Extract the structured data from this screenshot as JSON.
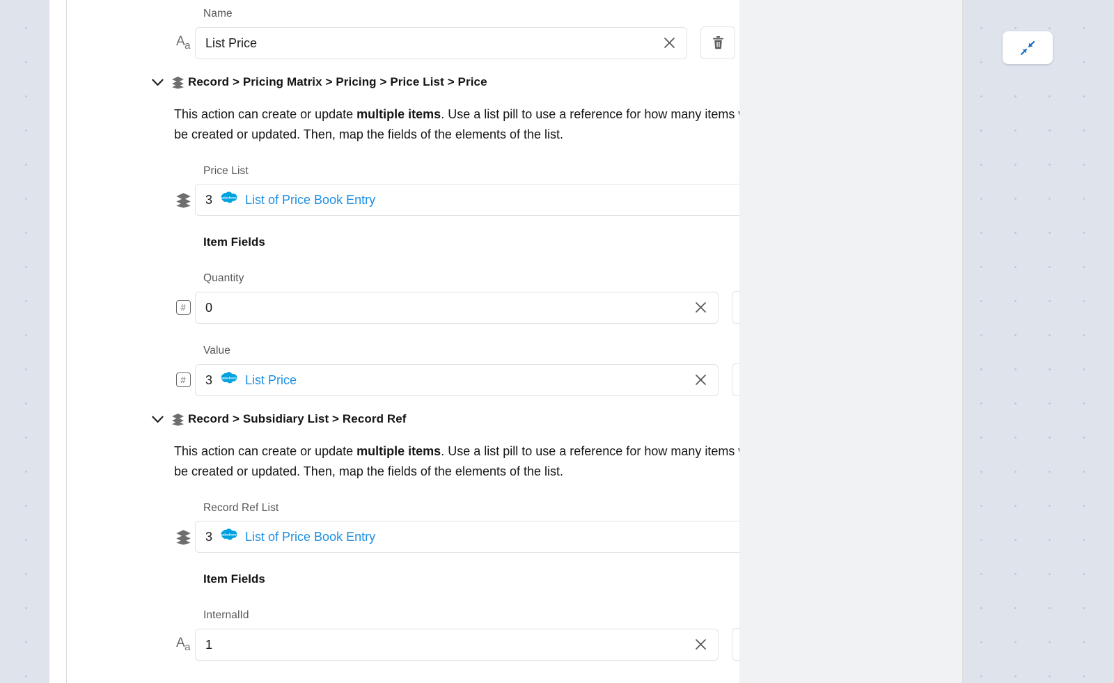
{
  "colors": {
    "canvas_bg": "#dee3ec",
    "panel_bg": "#f1f2f3",
    "panel_inner_bg": "#ffffff",
    "link_blue": "#1c8fe3",
    "salesforce_blue": "#00a1e0",
    "label_gray": "#585858",
    "text_dark": "#161616",
    "border_gray": "#e3e3e3"
  },
  "collapse_button": {
    "icon": "collapse-arrows-icon"
  },
  "name_field": {
    "label": "Name",
    "icon": "text-type-icon",
    "icon_glyph": "Aa",
    "value": "List Price",
    "clear_icon": "close-icon",
    "delete_icon": "trash-icon"
  },
  "sections": [
    {
      "chevron_icon": "chevron-down-icon",
      "layers_icon": "layers-icon",
      "title": "Record > Pricing Matrix > Pricing > Price List > Price",
      "description_parts": {
        "before": "This action can create or update ",
        "bold": "multiple items",
        "after": ". Use a list pill to use a reference for how many items will be created or updated. Then, map the fields of the elements of the list."
      },
      "list_field": {
        "label": "Price List",
        "icon": "layers-icon",
        "count": "3",
        "pill_icon": "salesforce-cloud-icon",
        "pill_label": "List of Price Book Entry",
        "clear_icon": "close-icon"
      },
      "item_fields_heading": "Item Fields",
      "item_fields": [
        {
          "label": "Quantity",
          "icon": "number-type-icon",
          "icon_glyph": "#",
          "value": "0",
          "is_pill": false,
          "clear_icon": "close-icon",
          "delete_icon": "trash-icon"
        },
        {
          "label": "Value",
          "icon": "number-type-icon",
          "icon_glyph": "#",
          "count": "3",
          "pill_icon": "salesforce-cloud-icon",
          "pill_label": "List Price",
          "is_pill": true,
          "clear_icon": "close-icon",
          "delete_icon": "trash-icon"
        }
      ]
    },
    {
      "chevron_icon": "chevron-down-icon",
      "layers_icon": "layers-icon",
      "title": "Record > Subsidiary List > Record Ref",
      "description_parts": {
        "before": "This action can create or update ",
        "bold": "multiple items",
        "after": ". Use a list pill to use a reference for how many items will be created or updated. Then, map the fields of the elements of the list."
      },
      "list_field": {
        "label": "Record Ref List",
        "icon": "layers-icon",
        "count": "3",
        "pill_icon": "salesforce-cloud-icon",
        "pill_label": "List of Price Book Entry",
        "clear_icon": "close-icon"
      },
      "item_fields_heading": "Item Fields",
      "item_fields": [
        {
          "label": "InternalId",
          "icon": "text-type-icon",
          "icon_glyph": "Aa",
          "value": "1",
          "is_pill": false,
          "clear_icon": "close-icon",
          "delete_icon": "trash-icon"
        }
      ]
    }
  ]
}
